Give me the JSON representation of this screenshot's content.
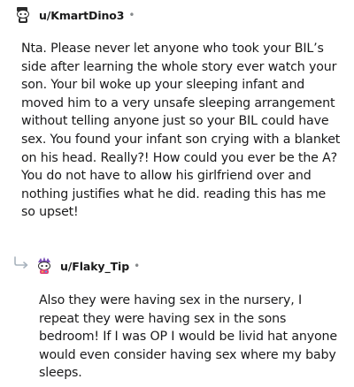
{
  "comments": [
    {
      "username": "u/KmartDino3",
      "separator": "•",
      "avatar_icon": "snoo-avatar-icon",
      "body": "Nta. Please never let anyone who took your BIL’s side after learning the whole story ever watch your son. Your bil woke up your sleeping infant and moved him to a very unsafe sleeping arrangement without telling anyone just so your BIL could have sex. You found your infant son crying with a blanket on his head. Really?! How could you ever be the A? You do not have to allow his girlfriend over and nothing justifies what he did. reading this has me so upset!"
    },
    {
      "username": "u/Flaky_Tip",
      "separator": "•",
      "avatar_icon": "snoo-avatar-icon",
      "reply_icon": "reply-arrow-icon",
      "body": "Also they were having sex in the nursery, I repeat they were having sex in the sons bedroom! If I was OP I would be livid hat anyone would even consider having sex where my baby sleeps."
    }
  ],
  "colors": {
    "text": "#1a1a1b",
    "meta": "#878a8c",
    "reply_arrow": "#a8b3bd"
  }
}
